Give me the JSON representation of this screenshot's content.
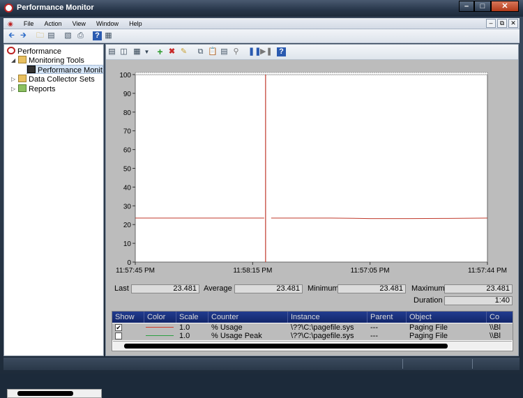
{
  "window": {
    "title": "Performance Monitor"
  },
  "menubar": {
    "items": [
      "File",
      "Action",
      "View",
      "Window",
      "Help"
    ]
  },
  "tree": {
    "root": "Performance",
    "monitoring_tools": "Monitoring Tools",
    "performance_monitor": "Performance Monitor",
    "data_collector_sets": "Data Collector Sets",
    "reports": "Reports"
  },
  "chart_data": {
    "type": "line",
    "ylim": [
      0,
      100
    ],
    "yticks": [
      "100",
      "90",
      "80",
      "70",
      "60",
      "50",
      "40",
      "30",
      "20",
      "10",
      "0"
    ],
    "xticks": [
      "11:57:45 PM",
      "11:58:15 PM",
      "11:57:05 PM",
      "11:57:44 PM"
    ],
    "series": [
      {
        "name": "% Usage",
        "color": "#c0392b",
        "values": [
          23.481,
          23.481,
          23.481,
          23.481,
          23.481,
          23.481,
          23.2,
          23.2,
          23.3,
          23.481
        ]
      }
    ],
    "cursor_position": 0.37
  },
  "stats": {
    "last_label": "Last",
    "last_value": "23.481",
    "average_label": "Average",
    "average_value": "23.481",
    "minimum_label": "Minimum",
    "minimum_value": "23.481",
    "maximum_label": "Maximum",
    "maximum_value": "23.481",
    "duration_label": "Duration",
    "duration_value": "1:40"
  },
  "grid": {
    "headers": [
      "Show",
      "Color",
      "Scale",
      "Counter",
      "Instance",
      "Parent",
      "Object",
      "Co"
    ],
    "rows": [
      {
        "checked": true,
        "color": "#d03a2a",
        "scale": "1.0",
        "counter": "% Usage",
        "instance": "\\??\\C:\\pagefile.sys",
        "parent": "---",
        "object": "Paging File",
        "computer": "\\\\Bl"
      },
      {
        "checked": false,
        "color": "#2aa040",
        "scale": "1.0",
        "counter": "% Usage Peak",
        "instance": "\\??\\C:\\pagefile.sys",
        "parent": "---",
        "object": "Paging File",
        "computer": "\\\\Bl"
      }
    ]
  }
}
